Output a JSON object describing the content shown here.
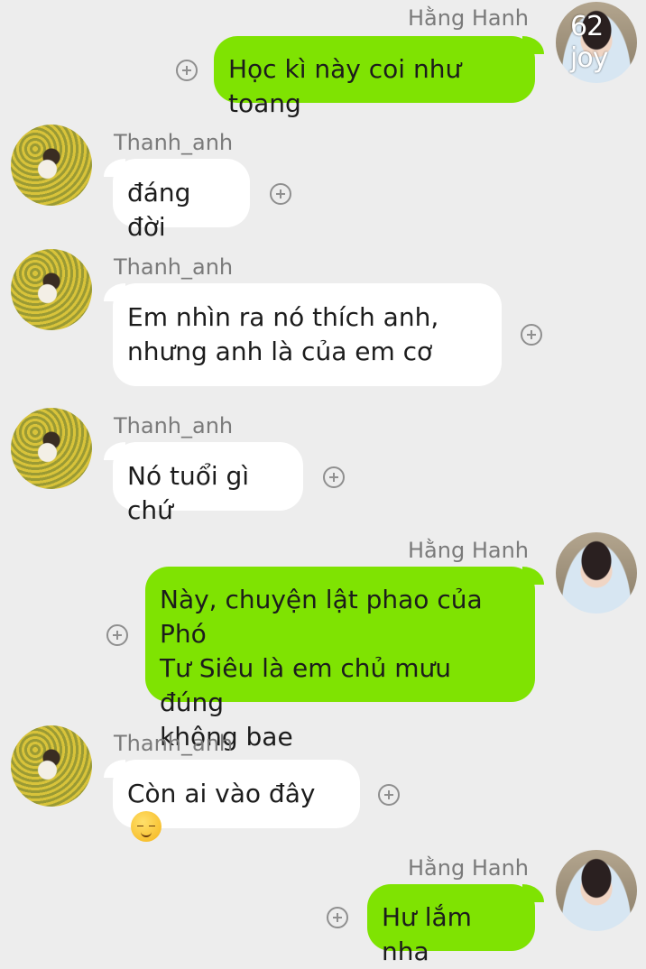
{
  "badge": "62 joy",
  "senders": {
    "me": "Hằng Hanh",
    "them": "Thanh_anh"
  },
  "messages": [
    {
      "sender": "Hằng Hanh",
      "lines": [
        "Học kì này coi như toang"
      ]
    },
    {
      "sender": "Thanh_anh",
      "lines": [
        "đáng đời"
      ]
    },
    {
      "sender": "Thanh_anh",
      "lines": [
        "Em nhìn ra nó thích anh,",
        "nhưng anh là của em cơ"
      ]
    },
    {
      "sender": "Thanh_anh",
      "lines": [
        "Nó tuổi gì chứ"
      ]
    },
    {
      "sender": "Hằng Hanh",
      "lines": [
        "Này, chuyện lật phao của Phó",
        "Tư Siêu là em chủ mưu đúng",
        "không bae"
      ]
    },
    {
      "sender": "Thanh_anh",
      "lines": [
        "Còn ai vào đây"
      ],
      "emoji": "relieved-face-emoji"
    },
    {
      "sender": "Hằng Hanh",
      "lines": [
        "Hư lắm nha"
      ]
    }
  ],
  "colors": {
    "background": "#ededed",
    "outgoing_bubble": "#7fe302",
    "incoming_bubble": "#ffffff"
  }
}
